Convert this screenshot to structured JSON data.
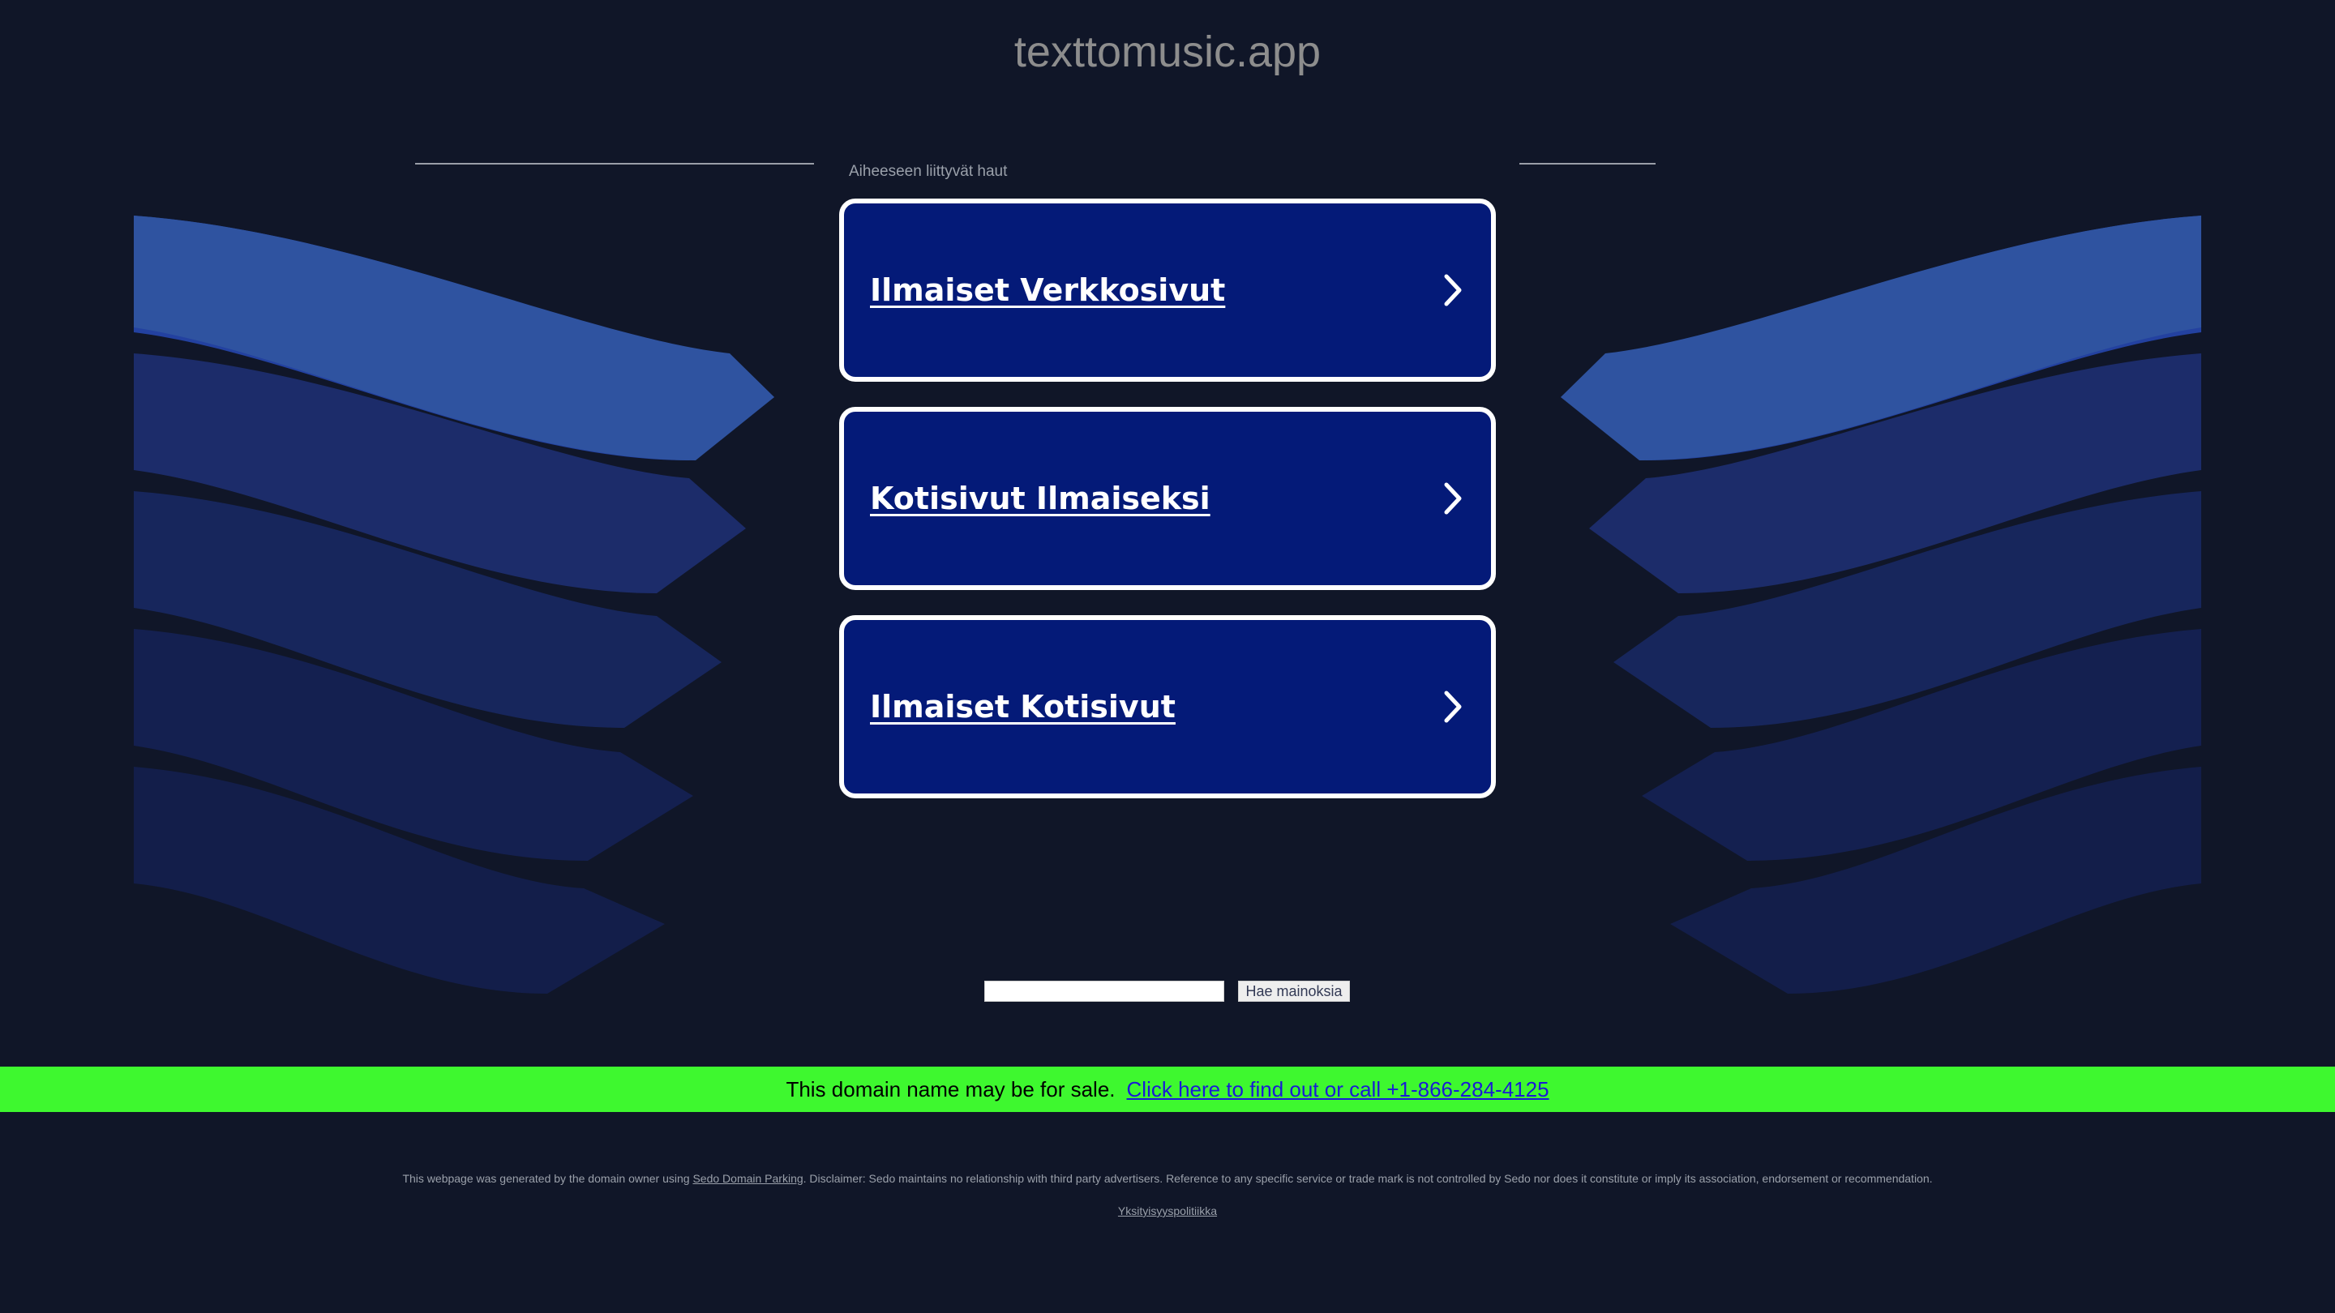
{
  "site": {
    "title": "texttomusic.app"
  },
  "related": {
    "label": "Aiheeseen liittyvät haut",
    "items": [
      {
        "label": "Ilmaiset Verkkosivut"
      },
      {
        "label": "Kotisivut Ilmaiseksi"
      },
      {
        "label": "Ilmaiset Kotisivut"
      }
    ]
  },
  "search": {
    "value": "",
    "button_label": "Hae mainoksia"
  },
  "sale_banner": {
    "text": "This domain name may be for sale.",
    "link_text": "Click here to find out or call +1-866-284-4125"
  },
  "footer": {
    "disclaimer_prefix": "This webpage was generated by the domain owner using",
    "sedo_link": "Sedo Domain Parking",
    "disclaimer_suffix": ". Disclaimer: Sedo maintains no relationship with third party advertisers. Reference to any specific service or trade mark is not controlled by Sedo nor does it constitute or imply its association, endorsement or recommendation.",
    "privacy_link": "Yksityisyyspolitiikka"
  },
  "colors": {
    "background": "#101628",
    "card_fill": "#041a78",
    "card_border": "#ffffff",
    "banner": "#3ef82f",
    "link": "#1a1ad6",
    "wave_1": "#2f53a0",
    "wave_2": "#2341a0",
    "wave_3": "#1c2c6a",
    "wave_4": "#17265c",
    "wave_5": "#142050",
    "wave_6": "#131e4a"
  }
}
